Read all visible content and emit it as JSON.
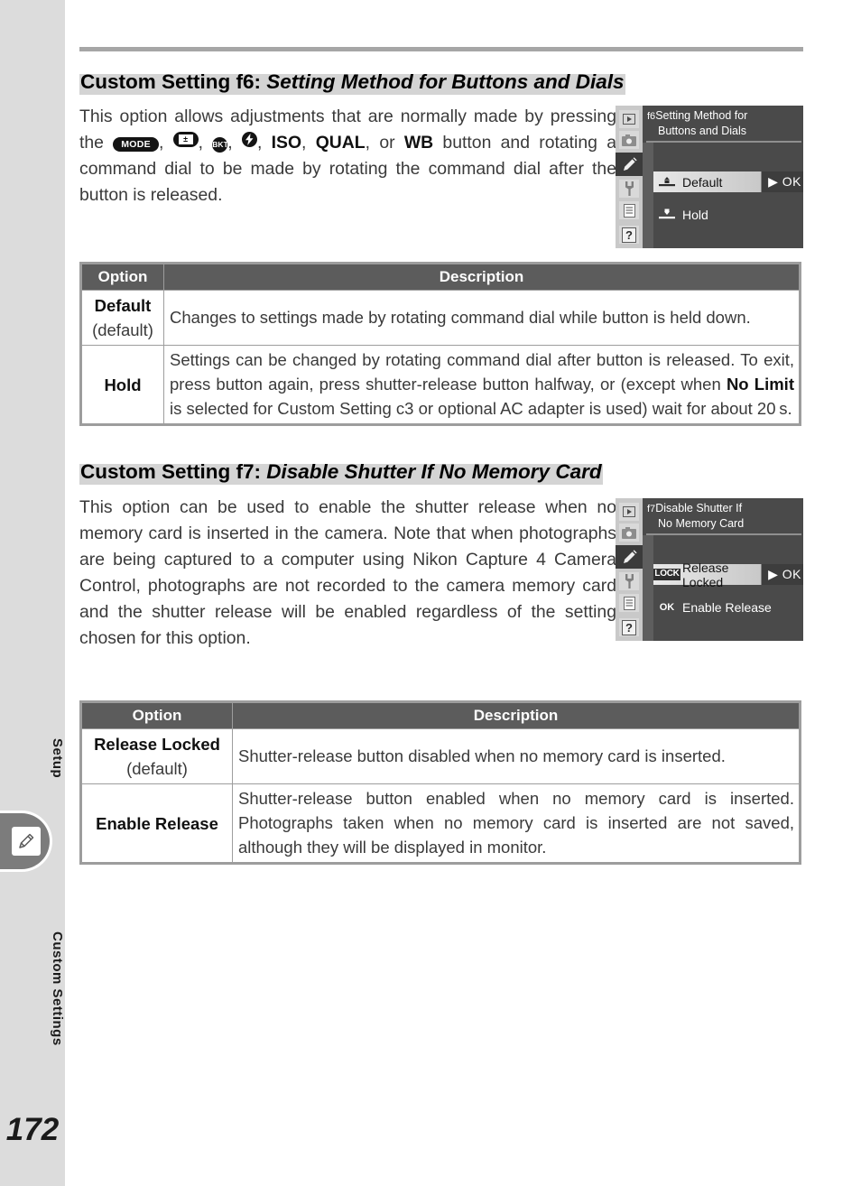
{
  "sidebar": {
    "label_setup": "Setup",
    "label_custom_settings": "Custom Settings",
    "tab_icon": "pencil-icon",
    "page_number": "172"
  },
  "sections": [
    {
      "heading_prefix": "Custom Setting f6:",
      "heading_italic": "Setting Method for Buttons and Dials",
      "paragraph_parts": {
        "p1": "This option allows adjustments that are normally made by pressing the ",
        "btn1": "MODE",
        "sep1": ", ",
        "btn2": "exposure-compensation",
        "btn2_glyph": "±",
        "sep2": ", ",
        "btn3": "BKT",
        "sep3": ", ",
        "btn4": "flash-icon",
        "sep4": ", ",
        "t_iso": "ISO",
        "sep5": ", ",
        "t_qual": "QUAL",
        "sep6": ", or ",
        "t_wb": "WB",
        "p2": " button and rotating a command dial to be made by rotating the command dial after the button is released."
      },
      "camera_menu": {
        "title_line1": "Setting Method for",
        "title_line2": "Buttons and Dials",
        "title_number": "f6",
        "rows": [
          {
            "badge": "",
            "icon": "press-hold-icon-a",
            "label": "Default",
            "ok": "▶ OK",
            "selected": true
          },
          {
            "badge": "",
            "icon": "press-hold-icon-b",
            "label": "Hold",
            "ok": "",
            "selected": false
          }
        ],
        "rail_icons": [
          "play-icon",
          "camera-icon",
          "pencil-icon",
          "wrench-icon",
          "list-icon",
          "question-icon"
        ],
        "rail_selected_index": 2
      },
      "table": {
        "headers": [
          "Option",
          "Description"
        ],
        "rows": [
          {
            "option": "Default",
            "option_sub": "(default)",
            "description": "Changes to settings made by rotating command dial while button is held down.",
            "justify": true
          },
          {
            "option": "Hold",
            "option_sub": "",
            "desc_pre": "Settings can be changed by rotating command dial after button is released. To exit, press button again, press shutter-release button halfway, or (except when ",
            "desc_bold": "No Limit",
            "desc_post": " is selected for Custom Setting c3 or optional AC adapter is used) wait for about 20 s.",
            "justify": true
          }
        ]
      }
    },
    {
      "heading_prefix": "Custom Setting f7:",
      "heading_italic": "Disable Shutter If No Memory Card",
      "paragraph": "This option can be used to enable the shutter release when no memory card is inserted in the camera.  Note that when photographs are being captured to a computer using Nikon Capture 4 Camera Control, photographs are not recorded to the camera memory card and the shutter release will be enabled regardless of the setting chosen for this option.",
      "camera_menu": {
        "title_line1": "Disable Shutter If",
        "title_line2": "No Memory Card",
        "title_number": "f7",
        "rows": [
          {
            "badge": "LOCK",
            "label": "Release Locked",
            "ok": "▶ OK",
            "selected": true
          },
          {
            "badge": "OK",
            "label": "Enable Release",
            "ok": "",
            "selected": false
          }
        ],
        "rail_icons": [
          "play-icon",
          "camera-icon",
          "pencil-icon",
          "wrench-icon",
          "list-icon",
          "question-icon"
        ],
        "rail_selected_index": 2
      },
      "table": {
        "headers": [
          "Option",
          "Description"
        ],
        "rows": [
          {
            "option": "Release Locked",
            "option_sub": "(default)",
            "description": "Shutter-release button disabled when no memory card is inserted.",
            "justify": false
          },
          {
            "option": "Enable Release",
            "option_sub": "",
            "description": "Shutter-release button enabled when no memory card is inserted. Photographs taken when no memory card is inserted are not saved, although they will be displayed in monitor.",
            "justify": true
          }
        ]
      }
    }
  ],
  "colors": {
    "sidebar_bg": "#dcdcdc",
    "tab_bg": "#7c7c7c",
    "table_header_bg": "#5c5c5c",
    "table_border": "#9d9d9d",
    "heading_highlight": "#d4d4d4",
    "rule": "#a6a6a6",
    "camera_bg": "#4a4a4a",
    "camera_rail": "#c9c9c9"
  }
}
